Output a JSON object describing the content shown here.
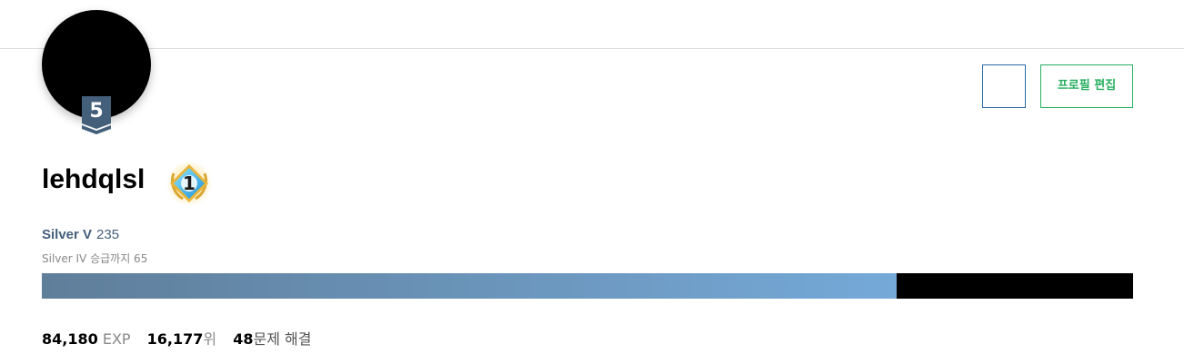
{
  "profile": {
    "username": "lehdqlsl",
    "level": "5",
    "class_badge_number": "1",
    "edit_button_label": "프로필 편집"
  },
  "tier": {
    "name": "Silver V",
    "rating": "235",
    "next_info": "Silver IV 승급까지 65",
    "progress_fraction": 0.783
  },
  "stats": {
    "exp_value": "84,180",
    "exp_unit": "EXP",
    "rank_value": "16,177",
    "rank_unit": "위",
    "solved_value": "48",
    "solved_unit": "문제 해결"
  },
  "colors": {
    "edit_button": "#27ae60",
    "icon_button_border": "#2a6aa8",
    "tier_text": "#435f7a",
    "progress_start": "#5f7e9a",
    "progress_end": "#75a9d8"
  }
}
